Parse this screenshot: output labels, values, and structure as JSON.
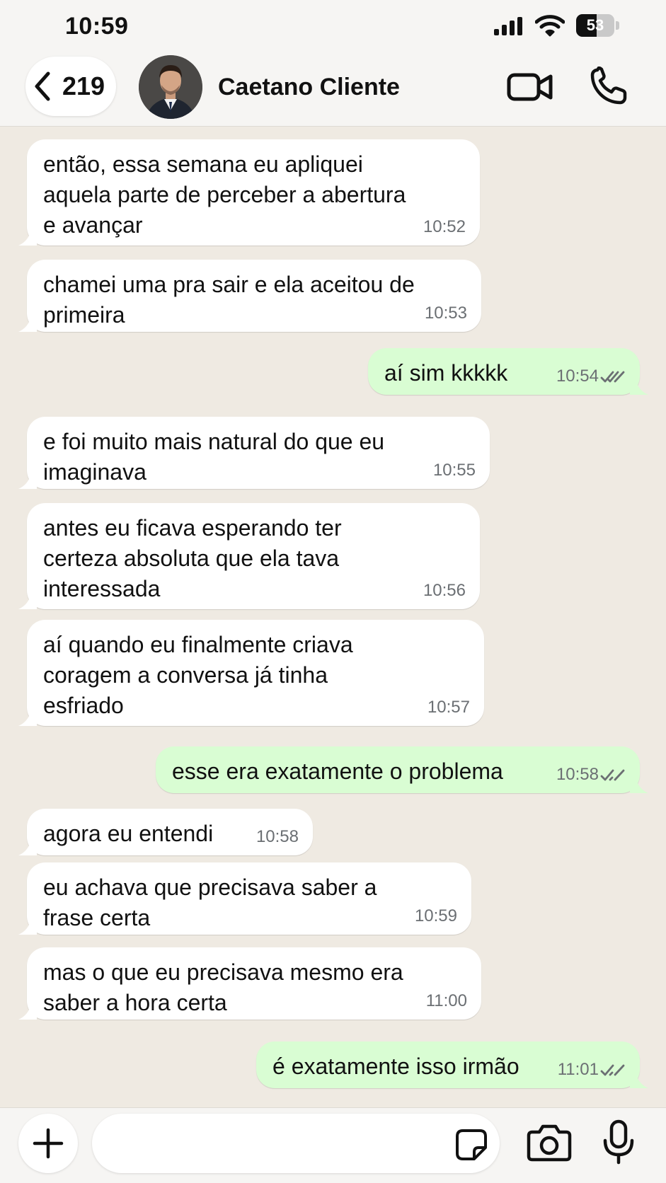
{
  "status_bar": {
    "time": "10:59",
    "signal_icon": "cellular-signal-icon",
    "wifi_icon": "wifi-icon",
    "battery_level": "53",
    "battery_fraction": 0.53
  },
  "header": {
    "back_count": "219",
    "back_icon": "chevron-left-icon",
    "contact_name": "Caetano Cliente",
    "video_icon": "video-camera-icon",
    "call_icon": "phone-icon"
  },
  "messages": [
    {
      "direction": "in",
      "text": "então, essa semana eu apliquei\naquela parte de perceber a abertura\ne avançar",
      "time": "10:52"
    },
    {
      "direction": "in",
      "text": "chamei uma pra sair e ela aceitou de\nprimeira",
      "time": "10:53"
    },
    {
      "direction": "out",
      "text": "aí sim kkkkk",
      "time": "10:54",
      "status": "read"
    },
    {
      "direction": "in",
      "text": "e foi muito mais natural do que eu\nimaginava",
      "time": "10:55"
    },
    {
      "direction": "in",
      "text": "antes eu ficava esperando ter\ncerteza absoluta que ela tava\ninteressada",
      "time": "10:56"
    },
    {
      "direction": "in",
      "text": "aí quando eu finalmente criava\ncoragem a conversa já tinha\nesfriado",
      "time": "10:57"
    },
    {
      "direction": "out",
      "text": "esse era exatamente o problema",
      "time": "10:58",
      "status": "read"
    },
    {
      "direction": "in",
      "text": "agora eu entendi",
      "time": "10:58"
    },
    {
      "direction": "in",
      "text": "eu achava que precisava saber a\nfrase certa",
      "time": "10:59"
    },
    {
      "direction": "in",
      "text": "mas o que eu precisava mesmo era\nsaber a hora certa",
      "time": "11:00"
    },
    {
      "direction": "out",
      "text": "é exatamente isso irmão",
      "time": "11:01",
      "status": "read"
    }
  ],
  "input_bar": {
    "plus_icon": "plus-icon",
    "input_value": "",
    "sticker_icon": "sticker-icon",
    "camera_icon": "camera-icon",
    "mic_icon": "microphone-icon"
  },
  "colors": {
    "chat_background": "#efeae2",
    "incoming_bubble": "#ffffff",
    "outgoing_bubble": "#d9fdd3",
    "read_ticks": "#6b6f73"
  }
}
